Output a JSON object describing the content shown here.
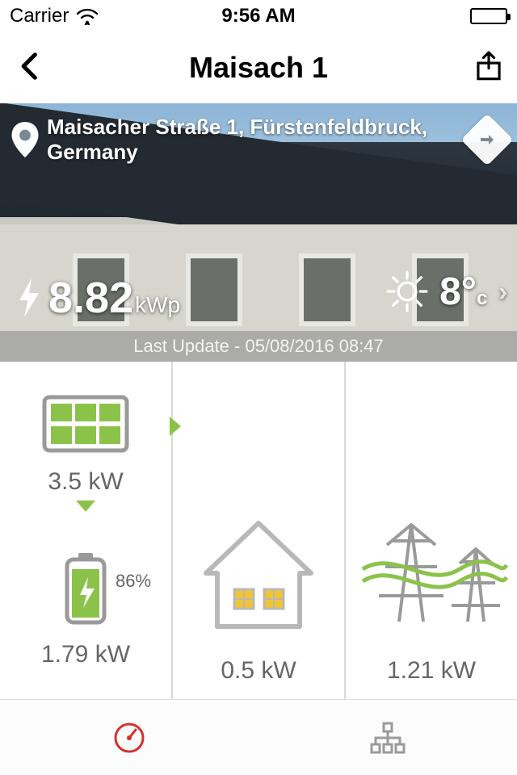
{
  "status": {
    "carrier": "Carrier",
    "time": "9:56 AM"
  },
  "nav": {
    "title": "Maisach 1"
  },
  "hero": {
    "address": "Maisacher Straße 1, Fürstenfeldbruck, Germany",
    "power_value": "8.82",
    "power_unit": "kWp",
    "temp_value": "8°",
    "temp_unit": "c",
    "last_update": "Last Update - 05/08/2016 08:47"
  },
  "flow": {
    "solar_value": "3.5 kW",
    "battery_percent": "86%",
    "battery_value": "1.79 kW",
    "home_value": "0.5 kW",
    "grid_value": "1.21 kW"
  }
}
